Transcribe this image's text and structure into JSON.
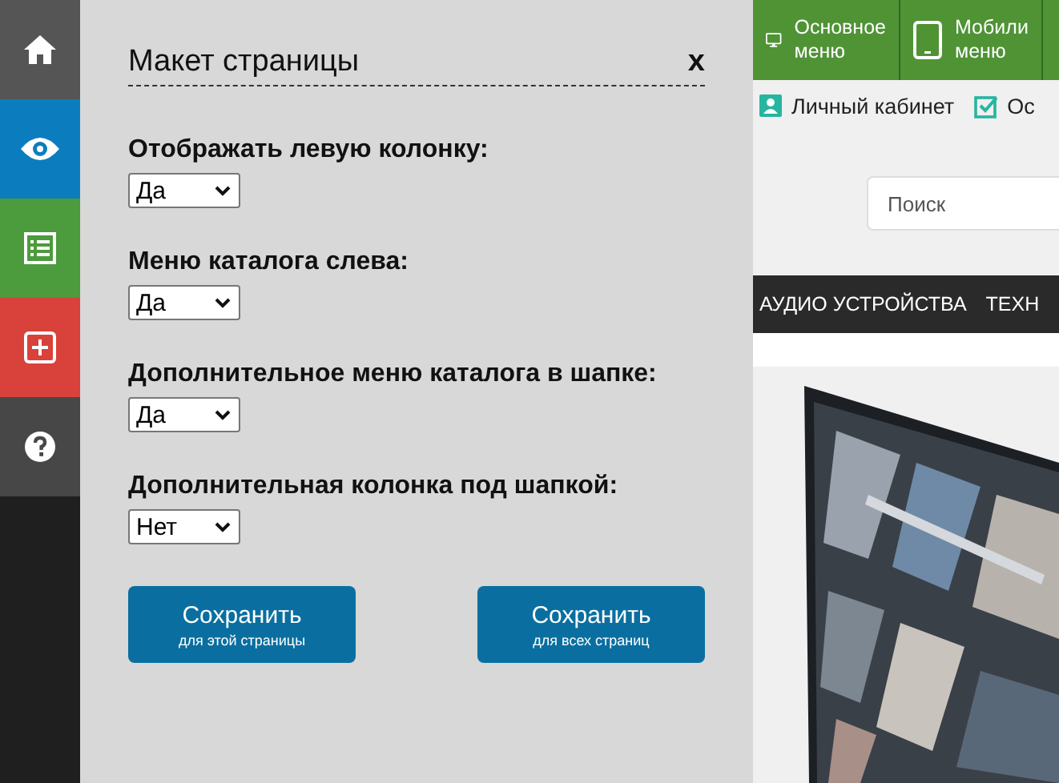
{
  "sidebar": {
    "items": [
      {
        "kind": "home",
        "color": "#555555"
      },
      {
        "kind": "eye",
        "color": "#0b7dbf"
      },
      {
        "kind": "list",
        "color": "#4c9b3c"
      },
      {
        "kind": "plus",
        "color": "#d9413b"
      },
      {
        "kind": "help",
        "color": "#474747"
      }
    ]
  },
  "dialog": {
    "title": "Макет страницы",
    "close": "x",
    "fields": [
      {
        "label": "Отображать левую колонку:",
        "value": "Да"
      },
      {
        "label": "Меню каталога слева:",
        "value": "Да"
      },
      {
        "label": "Дополнительное меню каталога в шапке:",
        "value": "Да"
      },
      {
        "label": "Дополнительная колонка под шапкой:",
        "value": "Нет"
      }
    ],
    "buttons": [
      {
        "label": "Сохранить",
        "sublabel": "для этой страницы"
      },
      {
        "label": "Сохранить",
        "sublabel": "для всех страниц"
      }
    ]
  },
  "top_menu": [
    {
      "kind": "monitor",
      "lines": [
        "Основное",
        "меню"
      ]
    },
    {
      "kind": "tablet",
      "lines": [
        "Мобили",
        "меню"
      ]
    }
  ],
  "links": [
    {
      "kind": "user",
      "label": "Личный кабинет"
    },
    {
      "kind": "check",
      "label": "Ос"
    }
  ],
  "search": {
    "placeholder": "Поиск"
  },
  "nav": [
    "АУДИО УСТРОЙСТВА",
    "ТЕХН"
  ]
}
